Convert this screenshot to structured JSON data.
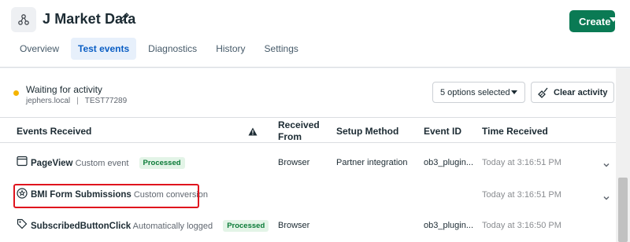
{
  "header": {
    "title": "J Market Data",
    "create_label": "Create",
    "colors": {
      "create_bg": "#0a7a54",
      "active_tab": "#0a5ec4"
    }
  },
  "tabs": [
    {
      "label": "Overview",
      "active": false
    },
    {
      "label": "Test events",
      "active": true
    },
    {
      "label": "Diagnostics",
      "active": false
    },
    {
      "label": "History",
      "active": false
    },
    {
      "label": "Settings",
      "active": false
    }
  ],
  "status": {
    "text": "Waiting for activity",
    "host": "jephers.local",
    "id": "TEST77289",
    "dot_color": "#f5b400"
  },
  "filter": {
    "selected": "5 options selected"
  },
  "clear_label": "Clear activity",
  "columns": {
    "events": "Events Received",
    "from": "Received From",
    "setup": "Setup Method",
    "event_id": "Event ID",
    "time": "Time Received"
  },
  "rows": [
    {
      "icon": "browser-window-icon",
      "name": "PageView",
      "type": "Custom event",
      "badge": "Processed",
      "from": "Browser",
      "setup": "Partner integration",
      "event_id": "ob3_plugin...",
      "time": "Today at 3:16:51 PM"
    },
    {
      "icon": "star-badge-icon",
      "name": "BMI Form Submissions",
      "type": "Custom conversion",
      "badge": "",
      "from": "",
      "setup": "",
      "event_id": "",
      "time": "Today at 3:16:51 PM"
    },
    {
      "icon": "tag-icon",
      "name": "SubscribedButtonClick",
      "type": "Automatically logged",
      "badge": "Processed",
      "from": "Browser",
      "setup": "",
      "event_id": "ob3_plugin...",
      "time": "Today at 3:16:50 PM"
    }
  ]
}
